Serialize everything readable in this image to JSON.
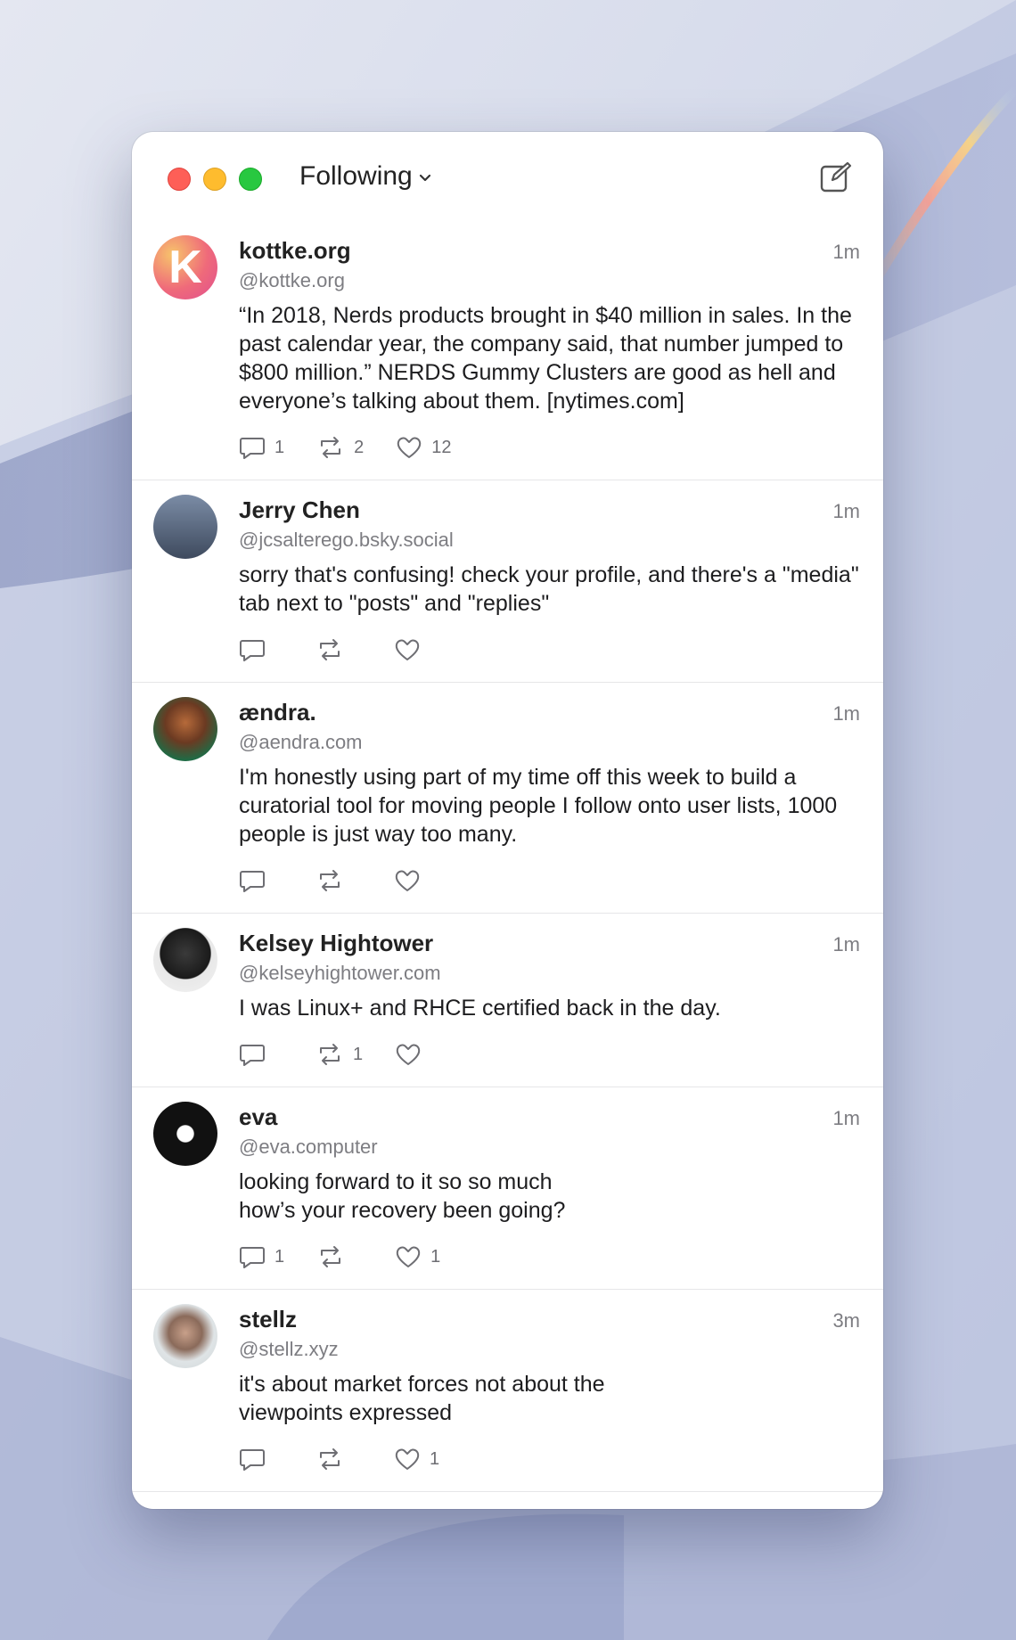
{
  "window": {
    "feed_label": "Following"
  },
  "icons": {
    "compose": "compose-icon",
    "reply": "reply-icon",
    "repost": "repost-icon",
    "like": "heart-icon",
    "chevron": "chevron-down-icon"
  },
  "colors": {
    "close": "#fe5f57",
    "minimize": "#febc2e",
    "zoom": "#28c840"
  },
  "posts": [
    {
      "name": "kottke.org",
      "handle": "@kottke.org",
      "time": "1m",
      "text": "“In 2018, Nerds products brought in $40 million in sales. In the past calendar year, the company said, that number jumped to $800 million.” NERDS Gummy Clusters are good as hell and everyone’s talking about them. [nytimes.com]",
      "replies": "1",
      "reposts": "2",
      "likes": "12",
      "avatar_letter": "K"
    },
    {
      "name": "Jerry Chen",
      "handle": "@jcsalterego.bsky.social",
      "time": "1m",
      "text": "sorry that's confusing! check your profile, and there's a \"media\" tab next to \"posts\" and \"replies\"",
      "replies": "",
      "reposts": "",
      "likes": ""
    },
    {
      "name": "ændra.",
      "handle": "@aendra.com",
      "time": "1m",
      "text": "I'm honestly using part of my time off this week to build a curatorial tool for moving people I follow onto user lists, 1000 people is just way too many.",
      "replies": "",
      "reposts": "",
      "likes": ""
    },
    {
      "name": "Kelsey Hightower",
      "handle": "@kelseyhightower.com",
      "time": "1m",
      "text": "I was Linux+ and RHCE certified back in the day.",
      "replies": "",
      "reposts": "1",
      "likes": ""
    },
    {
      "name": "eva",
      "handle": "@eva.computer",
      "time": "1m",
      "text": "looking forward to it so so much\nhow’s your recovery been going?",
      "replies": "1",
      "reposts": "",
      "likes": "1"
    },
    {
      "name": "stellz",
      "handle": "@stellz.xyz",
      "time": "3m",
      "text": "it's about market forces not about the\nviewpoints expressed",
      "replies": "",
      "reposts": "",
      "likes": "1"
    }
  ]
}
